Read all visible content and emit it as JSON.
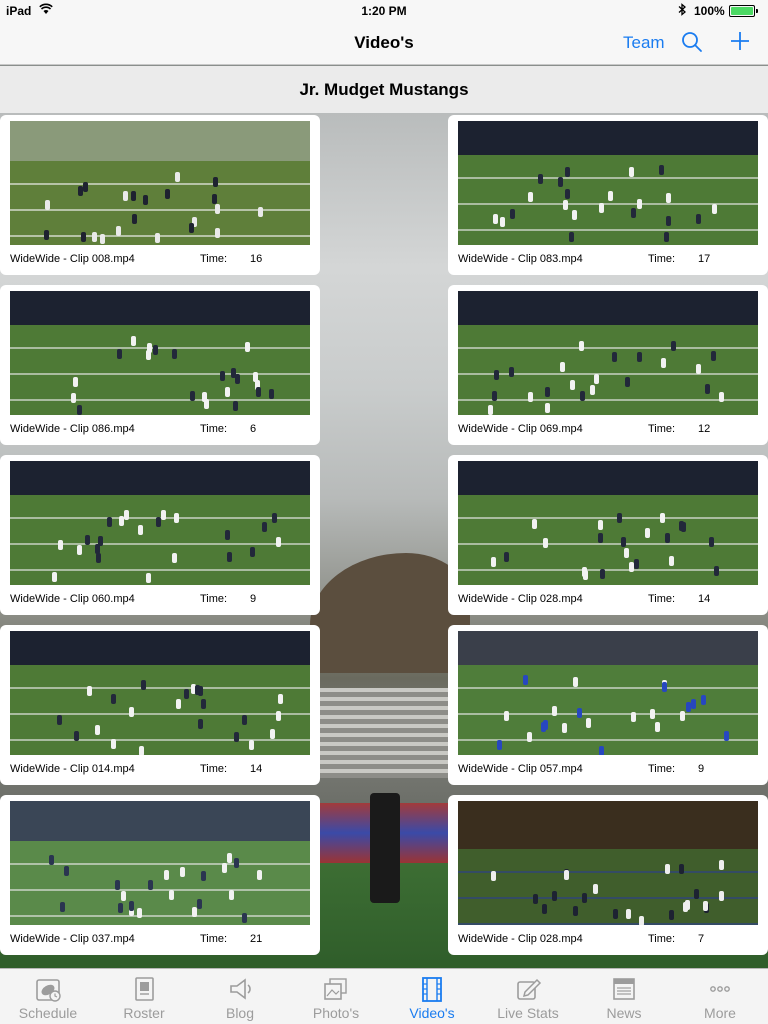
{
  "status_bar": {
    "device": "iPad",
    "time": "1:20 PM",
    "battery_pct": "100%",
    "battery_level": 1.0
  },
  "navbar": {
    "title": "Video's",
    "team_label": "Team",
    "search_icon": "search-icon",
    "add_icon": "plus-icon"
  },
  "section": {
    "title": "Jr. Mudget Mustangs"
  },
  "colors": {
    "accent": "#1a7cf0",
    "tab_inactive": "#9c9c9c",
    "card_bg": "#ffffff"
  },
  "videos": [
    {
      "name": "WideWide - Clip 008.mp4",
      "time_label": "Time:",
      "time": "16",
      "scene": "day"
    },
    {
      "name": "WideWide - Clip 083.mp4",
      "time_label": "Time:",
      "time": "17",
      "scene": "night"
    },
    {
      "name": "WideWide - Clip 086.mp4",
      "time_label": "Time:",
      "time": "6",
      "scene": "night"
    },
    {
      "name": "WideWide - Clip 069.mp4",
      "time_label": "Time:",
      "time": "12",
      "scene": "night"
    },
    {
      "name": "WideWide - Clip 060.mp4",
      "time_label": "Time:",
      "time": "9",
      "scene": "night"
    },
    {
      "name": "WideWide - Clip 028.mp4",
      "time_label": "Time:",
      "time": "14",
      "scene": "night"
    },
    {
      "name": "WideWide - Clip 014.mp4",
      "time_label": "Time:",
      "time": "14",
      "scene": "night"
    },
    {
      "name": "WideWide - Clip 057.mp4",
      "time_label": "Time:",
      "time": "9",
      "scene": "blue"
    },
    {
      "name": "WideWide - Clip 037.mp4",
      "time_label": "Time:",
      "time": "21",
      "scene": "dusk"
    },
    {
      "name": "WideWide - Clip 028.mp4",
      "time_label": "Time:",
      "time": "7",
      "scene": "gold"
    }
  ],
  "tabs": [
    {
      "label": "Schedule",
      "icon": "football-calendar-icon",
      "active": false
    },
    {
      "label": "Roster",
      "icon": "roster-book-icon",
      "active": false
    },
    {
      "label": "Blog",
      "icon": "megaphone-icon",
      "active": false
    },
    {
      "label": "Photo's",
      "icon": "photos-icon",
      "active": false
    },
    {
      "label": "Video's",
      "icon": "film-strip-icon",
      "active": true
    },
    {
      "label": "Live Stats",
      "icon": "edit-stats-icon",
      "active": false
    },
    {
      "label": "News",
      "icon": "newspaper-icon",
      "active": false
    },
    {
      "label": "More",
      "icon": "more-dots-icon",
      "active": false
    }
  ]
}
